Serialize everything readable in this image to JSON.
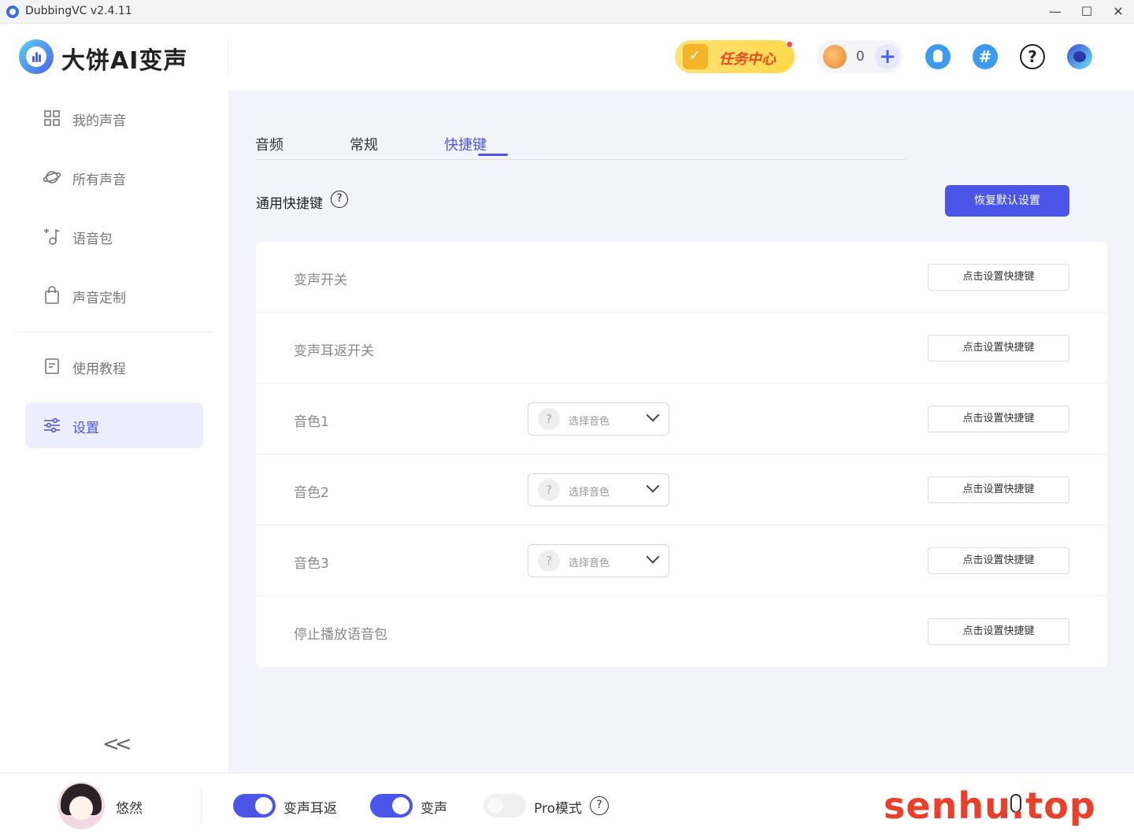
{
  "window": {
    "title": "DubbingVC v2.4.11",
    "controls": {
      "minimize": "—",
      "maximize": "☐",
      "close": "✕"
    }
  },
  "header": {
    "logo_text": "大饼AI变声",
    "task_center_label": "任务中心",
    "coin_count": "0",
    "coin_add": "+",
    "hash_symbol": "#",
    "help_symbol": "?"
  },
  "sidebar": {
    "items": [
      {
        "label": "我的声音",
        "icon": "grid-icon"
      },
      {
        "label": "所有声音",
        "icon": "planet-icon"
      },
      {
        "label": "语音包",
        "icon": "music-note-plus-icon"
      },
      {
        "label": "声音定制",
        "icon": "shopping-bag-icon"
      },
      {
        "label": "使用教程",
        "icon": "document-icon"
      },
      {
        "label": "设置",
        "icon": "sliders-icon",
        "active": true
      }
    ],
    "collapse_label": "<<"
  },
  "main": {
    "tabs": [
      {
        "label": "音频"
      },
      {
        "label": "常规"
      },
      {
        "label": "快捷键",
        "active": true
      }
    ],
    "section_title": "通用快捷键",
    "section_help": "?",
    "restore_button": "恢复默认设置",
    "shortcut_button_label": "点击设置快捷键",
    "voice_select_placeholder": "选择音色",
    "rows": [
      {
        "label": "变声开关"
      },
      {
        "label": "变声耳返开关"
      },
      {
        "label": "音色1",
        "has_select": true
      },
      {
        "label": "音色2",
        "has_select": true
      },
      {
        "label": "音色3",
        "has_select": true
      },
      {
        "label": "停止播放语音包"
      }
    ]
  },
  "bottombar": {
    "user_name": "悠然",
    "toggles": [
      {
        "label": "变声耳返",
        "on": true
      },
      {
        "label": "变声",
        "on": true
      },
      {
        "label": "Pro模式",
        "on": false
      }
    ],
    "pro_help": "?",
    "watermark": "senhu.top"
  },
  "colors": {
    "accent": "#4b55e8",
    "main_bg": "#f3f4fb",
    "task_center_bg": "#ffd84a"
  }
}
